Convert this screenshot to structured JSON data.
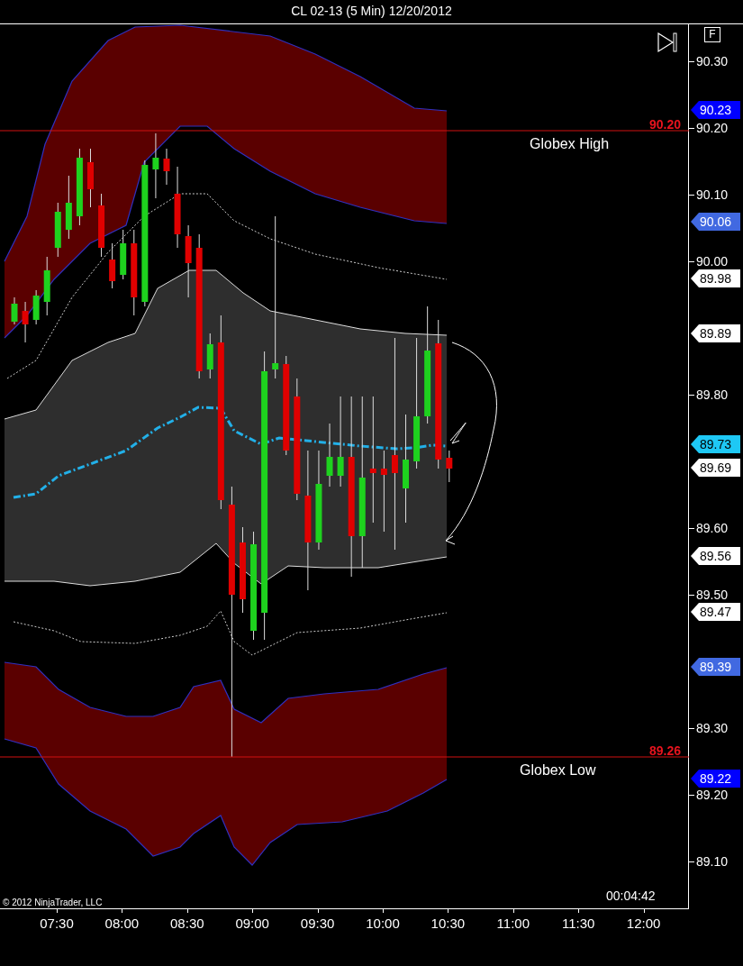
{
  "window": {
    "title": "CL 02-13 (5 Min)  12/20/2012"
  },
  "toolbar": {
    "f_button": "F"
  },
  "price_axis": {
    "ticks": [
      "90.30",
      "90.20",
      "90.10",
      "90.00",
      "89.80",
      "89.60",
      "89.50",
      "89.30",
      "89.20",
      "89.10"
    ],
    "tags": [
      {
        "text": "90.23",
        "color": "#0000ff"
      },
      {
        "text": "90.06",
        "color": "#4169e1"
      },
      {
        "text": "89.98",
        "color": "#ffffff"
      },
      {
        "text": "89.89",
        "color": "#ffffff"
      },
      {
        "text": "89.73",
        "color": "#1ec8f5"
      },
      {
        "text": "89.69",
        "color": "#ffffff"
      },
      {
        "text": "89.56",
        "color": "#ffffff"
      },
      {
        "text": "89.47",
        "color": "#ffffff"
      },
      {
        "text": "89.39",
        "color": "#4169e1"
      },
      {
        "text": "89.22",
        "color": "#0000ff"
      }
    ]
  },
  "levels": [
    {
      "value": "90.20",
      "caption": "Globex High"
    },
    {
      "value": "89.26",
      "caption": "Globex Low"
    }
  ],
  "time_axis": {
    "ticks": [
      "07:30",
      "08:00",
      "08:30",
      "09:00",
      "09:30",
      "10:00",
      "10:30",
      "11:00",
      "11:30",
      "12:00"
    ]
  },
  "bar_timer": "00:04:42",
  "copyright": "© 2012 NinjaTrader, LLC"
}
